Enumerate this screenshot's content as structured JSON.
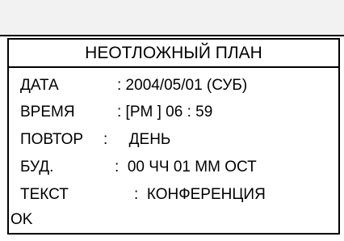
{
  "title": "НЕОТЛОЖНЫЙ ПЛАН",
  "fields": [
    {
      "label": "ДАТА",
      "value": ": 2004/05/01 (СУБ)"
    },
    {
      "label": "ВРЕМЯ",
      "value": ": [PM ] 06 : 59"
    },
    {
      "label": "ПОВТОР",
      "value": ":     ДЕНЬ"
    },
    {
      "label": "БУД.",
      "value": ":  00 ЧЧ 01 ММ ОСТ"
    },
    {
      "label": "ТЕКСТ",
      "value": ":  КОНФЕРЕНЦИЯ"
    }
  ],
  "ok_label": "OK"
}
